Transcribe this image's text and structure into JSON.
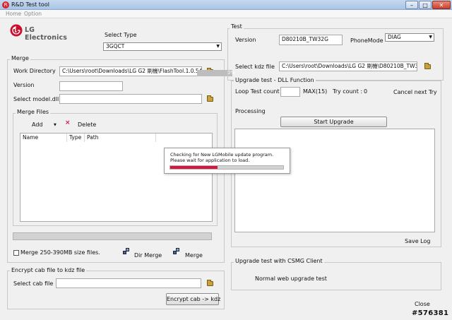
{
  "window": {
    "title": "R&D Test tool"
  },
  "menu": [
    "Home",
    "Option"
  ],
  "brand": {
    "logo_text": "LG Electronics",
    "logo_mark": "LG"
  },
  "select_type": {
    "label": "Select Type",
    "value": "3GQCT"
  },
  "merge": {
    "group_title": "Merge",
    "work_directory_label": "Work Directory",
    "work_directory_value": "C:\\Users\\root\\Downloads\\LG G2 刷機\\FlashTool.1.0.54",
    "version_label": "Version",
    "version_value": "",
    "select_model_label": "Select model.dll",
    "select_model_value": "",
    "overlay_percent": "0%"
  },
  "merge_files": {
    "title": "Merge Files",
    "add_label": "Add",
    "delete_label": "Delete",
    "columns": [
      "Name",
      "Type",
      "Path"
    ],
    "rows": []
  },
  "merge_options": {
    "merge_size_label": "Merge 250-390MB size files.",
    "merge_size_checked": false,
    "dir_merge_label": "Dir Merge",
    "merge_label": "Merge"
  },
  "encrypt": {
    "group_title": "Encrypt cab file to kdz file",
    "select_cab_label": "Select cab file",
    "select_cab_value": "",
    "encrypt_button": "Encrypt cab -> kdz"
  },
  "test": {
    "group_title": "Test",
    "version_label": "Version",
    "version_value": "D80210B_TW32G",
    "phone_mode_label": "PhoneMode",
    "phone_mode_value": "DIAG",
    "select_kdz_label": "Select kdz file",
    "select_kdz_value": "C:\\Users\\root\\Downloads\\LG G2 刷機\\D80210B_TW32G.kdz"
  },
  "upgrade": {
    "group_title": "Upgrade test - DLL Function",
    "loop_test_label": "Loop Test count",
    "loop_test_value": "",
    "max_label": "MAX(15)",
    "try_count_label": "Try count :",
    "try_count_value": "0",
    "cancel_next_try": "Cancel next Try",
    "processing_label": "Processing",
    "start_button": "Start Upgrade",
    "save_log": "Save Log"
  },
  "csmg": {
    "group_title": "Upgrade test with CSMG Client",
    "normal_web_label": "Normal web upgrade test"
  },
  "close_label": "Close",
  "watermark": "#576381",
  "dialog": {
    "line1": "Checking for New LGMobile update program.",
    "line2": "Please wait for application to load.",
    "progress": 0.42
  },
  "colors": {
    "accent": "#d6163d",
    "logo": "#c8102e"
  }
}
